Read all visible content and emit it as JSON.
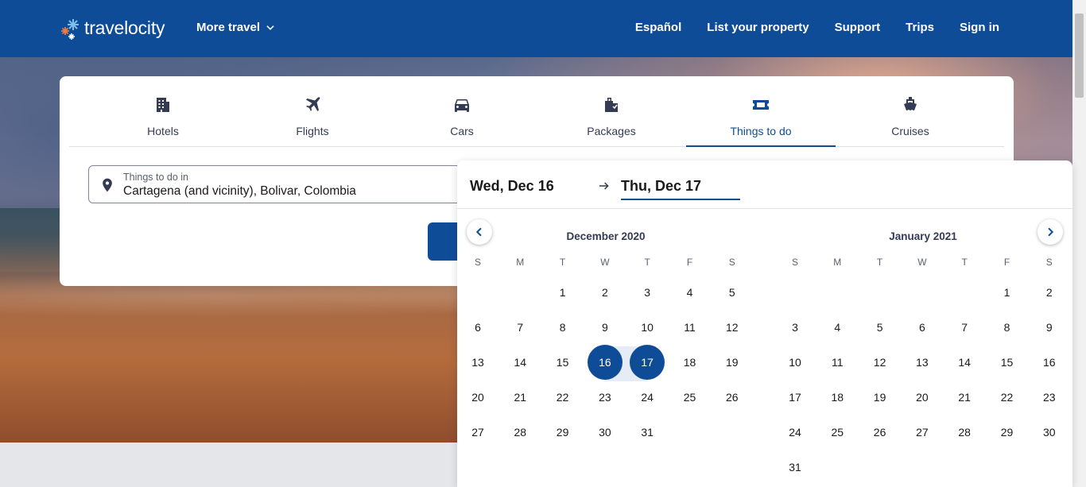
{
  "header": {
    "logo_text": "travelocity",
    "more_travel": "More travel",
    "nav": [
      "Español",
      "List your property",
      "Support",
      "Trips",
      "Sign in"
    ]
  },
  "tabs": [
    {
      "label": "Hotels",
      "icon": "hotel-icon"
    },
    {
      "label": "Flights",
      "icon": "plane-icon"
    },
    {
      "label": "Cars",
      "icon": "car-icon"
    },
    {
      "label": "Packages",
      "icon": "packages-icon"
    },
    {
      "label": "Things to do",
      "icon": "ticket-icon",
      "active": true
    },
    {
      "label": "Cruises",
      "icon": "cruise-icon"
    }
  ],
  "destination": {
    "label": "Things to do in",
    "value": "Cartagena (and vicinity), Bolivar, Colombia"
  },
  "picker": {
    "start_date": "Wed, Dec 16",
    "end_date": "Thu, Dec 17",
    "weekdays": [
      "S",
      "M",
      "T",
      "W",
      "T",
      "F",
      "S"
    ],
    "months": [
      {
        "title": "December 2020",
        "weeks": [
          [
            "",
            "",
            "1",
            "2",
            "3",
            "4",
            "5"
          ],
          [
            "6",
            "7",
            "8",
            "9",
            "10",
            "11",
            "12"
          ],
          [
            "13",
            "14",
            "15",
            "16",
            "17",
            "18",
            "19"
          ],
          [
            "20",
            "21",
            "22",
            "23",
            "24",
            "25",
            "26"
          ],
          [
            "27",
            "28",
            "29",
            "30",
            "31",
            "",
            ""
          ]
        ]
      },
      {
        "title": "January 2021",
        "weeks": [
          [
            "",
            "",
            "",
            "",
            "",
            "1",
            "2"
          ],
          [
            "3",
            "4",
            "5",
            "6",
            "7",
            "8",
            "9"
          ],
          [
            "10",
            "11",
            "12",
            "13",
            "14",
            "15",
            "16"
          ],
          [
            "17",
            "18",
            "19",
            "20",
            "21",
            "22",
            "23"
          ],
          [
            "24",
            "25",
            "26",
            "27",
            "28",
            "29",
            "30"
          ],
          [
            "31",
            "",
            "",
            "",
            "",
            "",
            ""
          ]
        ]
      }
    ],
    "selected": [
      "16",
      "17"
    ]
  },
  "colors": {
    "brand": "#0f4c98"
  }
}
